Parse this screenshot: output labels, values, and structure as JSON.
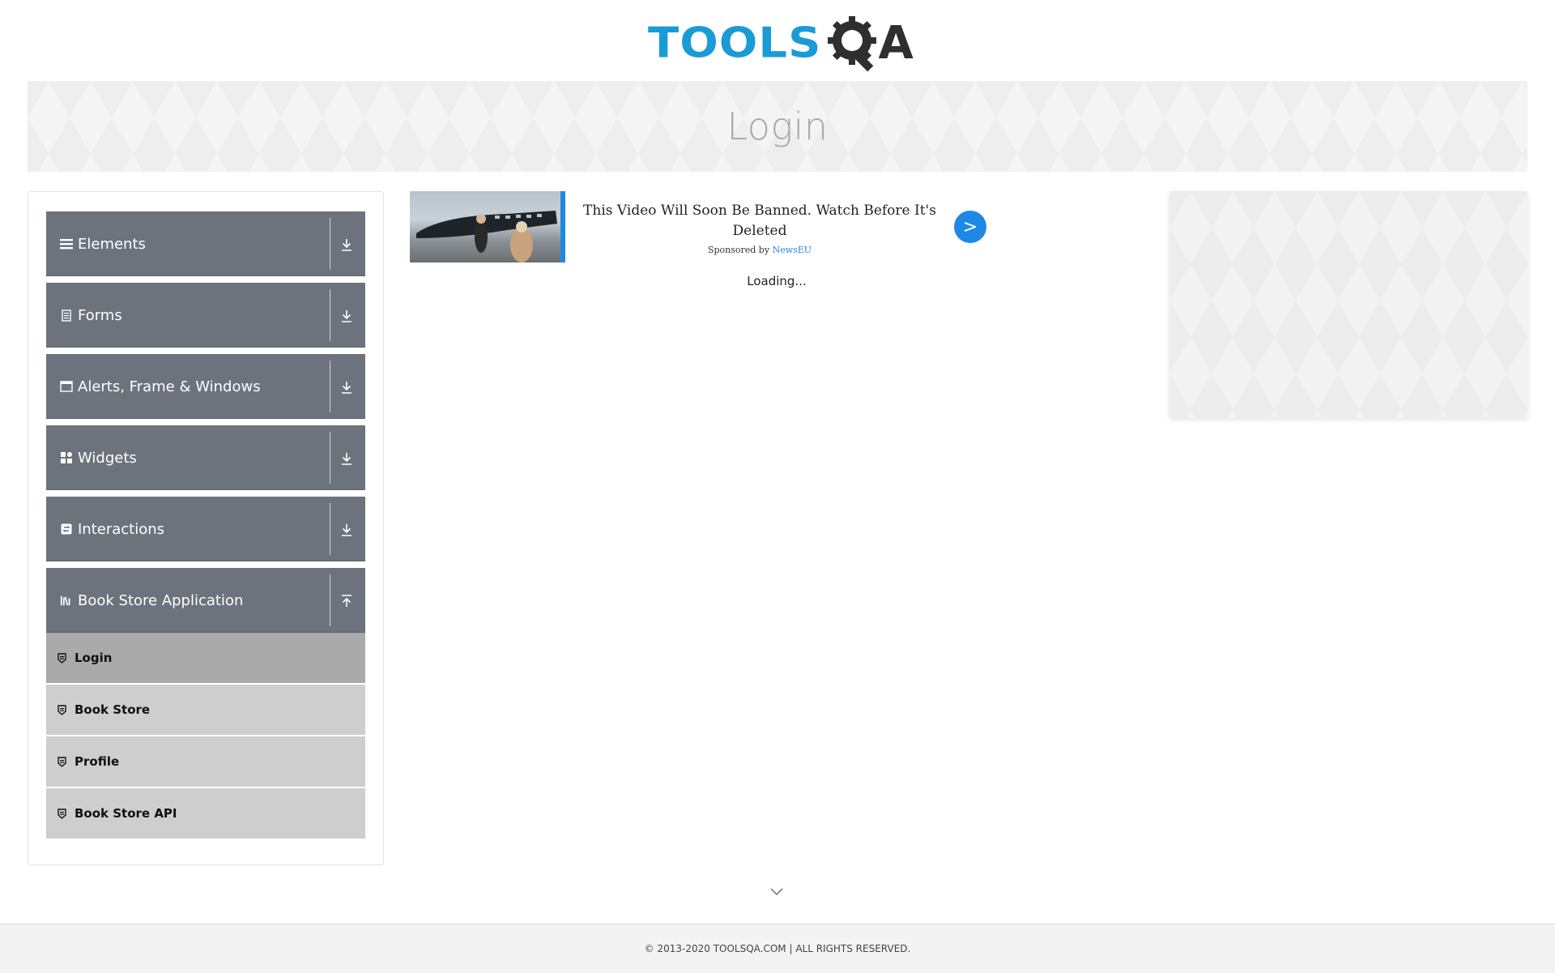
{
  "logo": {
    "brand_part1": "TOOLS",
    "brand_part2": "A",
    "tools_color": "#1b9bd6",
    "qa_color": "#2f2f2f"
  },
  "banner": {
    "title": "Login"
  },
  "sidebar": {
    "groups": [
      {
        "label": "Elements",
        "icon": "hamburger-icon",
        "state": "collapsed"
      },
      {
        "label": "Forms",
        "icon": "document-icon",
        "state": "collapsed"
      },
      {
        "label": "Alerts, Frame & Windows",
        "icon": "window-icon",
        "state": "collapsed"
      },
      {
        "label": "Widgets",
        "icon": "grid-icon",
        "state": "collapsed"
      },
      {
        "label": "Interactions",
        "icon": "interaction-icon",
        "state": "collapsed"
      },
      {
        "label": "Book Store Application",
        "icon": "books-icon",
        "state": "expanded"
      }
    ],
    "subitems": [
      {
        "label": "Login",
        "icon": "shield-icon",
        "active": true
      },
      {
        "label": "Book Store",
        "icon": "shield-icon",
        "active": false
      },
      {
        "label": "Profile",
        "icon": "shield-icon",
        "active": false
      },
      {
        "label": "Book Store API",
        "icon": "shield-icon",
        "active": false
      }
    ]
  },
  "ad": {
    "headline": "This Video Will Soon Be Banned. Watch Before It's Deleted",
    "sponsor_prefix": "Sponsored by",
    "sponsor_name": "NewsEU",
    "button_label": ">",
    "accent_color": "#1e88e5"
  },
  "main": {
    "loading_text": "Loading..."
  },
  "footer": {
    "text": "© 2013-2020 TOOLSQA.COM | ALL RIGHTS RESERVED."
  },
  "colors": {
    "sidebar_group_bg": "#6c737c",
    "sidebar_sub_bg": "#cecece",
    "sidebar_sub_active_bg": "#aaaaaa"
  }
}
